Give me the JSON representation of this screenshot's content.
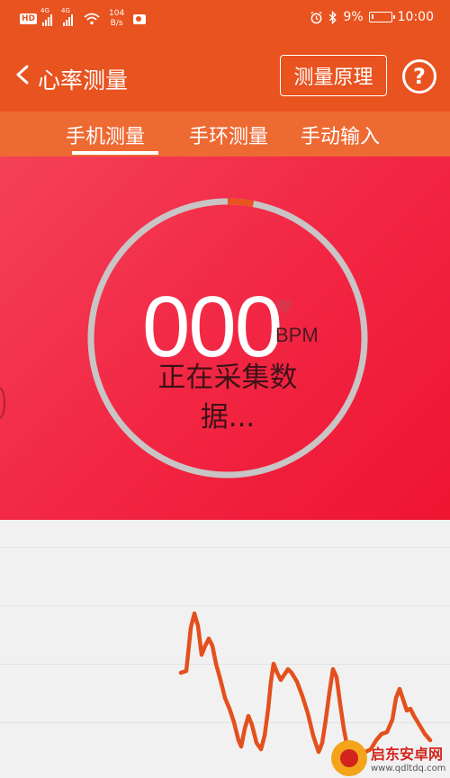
{
  "status_bar": {
    "hd": "HD",
    "net1": "4G",
    "net2": "4G",
    "speed_value": "104",
    "speed_unit": "B/s",
    "battery": "9%",
    "time": "10:00",
    "battery_level": 0.09
  },
  "app_bar": {
    "title": "心率测量",
    "principle_button": "测量原理",
    "help": "?"
  },
  "tabs": [
    {
      "label": "手机测量",
      "active": true
    },
    {
      "label": "手环测量",
      "active": false
    },
    {
      "label": "手动输入",
      "active": false
    }
  ],
  "measurement": {
    "bpm_value": "000",
    "bpm_unit": "BPM",
    "status": "正在采集数据...",
    "progress": 0.03
  },
  "waveform": {
    "color": "#e4501d"
  },
  "watermark": {
    "name": "启东安卓网",
    "url": "www.qdltdq.com"
  },
  "colors": {
    "primary": "#e8531f",
    "tab_bg": "#ee6a33",
    "hero": "#f22744",
    "ring_track": "#c9c4c5",
    "ring_progress": "#e8531f"
  }
}
